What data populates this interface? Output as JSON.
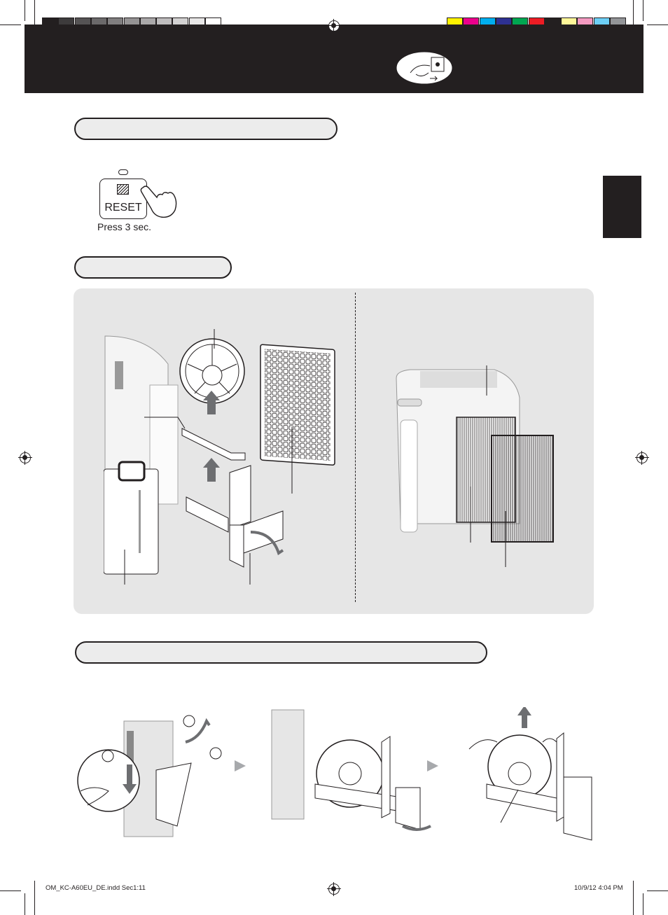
{
  "color_bar": {
    "grays": [
      "#231f20",
      "#3d3b3c",
      "#555354",
      "#6b696a",
      "#807e7f",
      "#959394",
      "#aaa8a9",
      "#bfbdbe",
      "#d3d2d2",
      "#e8e7e7",
      "#ffffff"
    ],
    "colors": [
      "#fff200",
      "#ec008c",
      "#00aeef",
      "#2e3192",
      "#00a651",
      "#ed1c24",
      "#231f20",
      "#fff799",
      "#f49ac1",
      "#6dcff6",
      "#939598"
    ]
  },
  "reset": {
    "button_label": "RESET",
    "instruction": "Press 3 sec."
  },
  "footer": {
    "file": "OM_KC-A60EU_DE.indd   Sec1:11",
    "timestamp": "10/9/12   4:04 PM"
  }
}
